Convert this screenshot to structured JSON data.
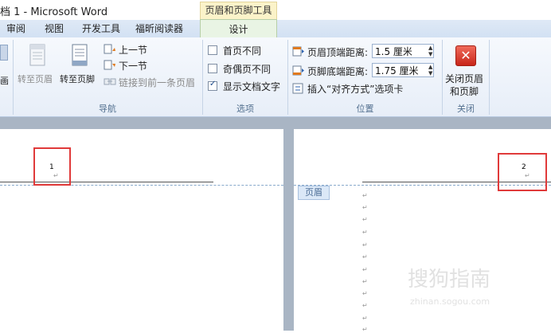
{
  "window": {
    "title": "档 1 - Microsoft Word",
    "contextual_title": "页眉和页脚工具"
  },
  "tabs": [
    "审阅",
    "视图",
    "开发工具",
    "福昕阅读器"
  ],
  "active_tab": "设计",
  "ribbon": {
    "partial_label": "画",
    "nav": {
      "goto_header": "转至页眉",
      "goto_footer": "转至页脚",
      "prev_section": "上一节",
      "next_section": "下一节",
      "link_prev": "链接到前一条页眉",
      "group_label": "导航"
    },
    "options": {
      "first_page_diff": "首页不同",
      "odd_even_diff": "奇偶页不同",
      "show_doc_text": "显示文档文字",
      "group_label": "选项",
      "first_page_checked": false,
      "odd_even_checked": false,
      "show_doc_text_checked": true
    },
    "position": {
      "header_top_label": "页眉顶端距离:",
      "header_top_value": "1.5 厘米",
      "footer_bottom_label": "页脚底端距离:",
      "footer_bottom_value": "1.75 厘米",
      "insert_tab": "插入“对齐方式”选项卡",
      "group_label": "位置"
    },
    "close": {
      "close_label_1": "关闭页眉",
      "close_label_2": "和页脚",
      "group_label": "关闭"
    }
  },
  "document": {
    "page1_number": "1",
    "page2_number": "2",
    "header_tag": "页眉",
    "para_mark": "↵"
  },
  "watermark": {
    "main": "搜狗指南",
    "sub": "zhinan.sogou.com"
  }
}
